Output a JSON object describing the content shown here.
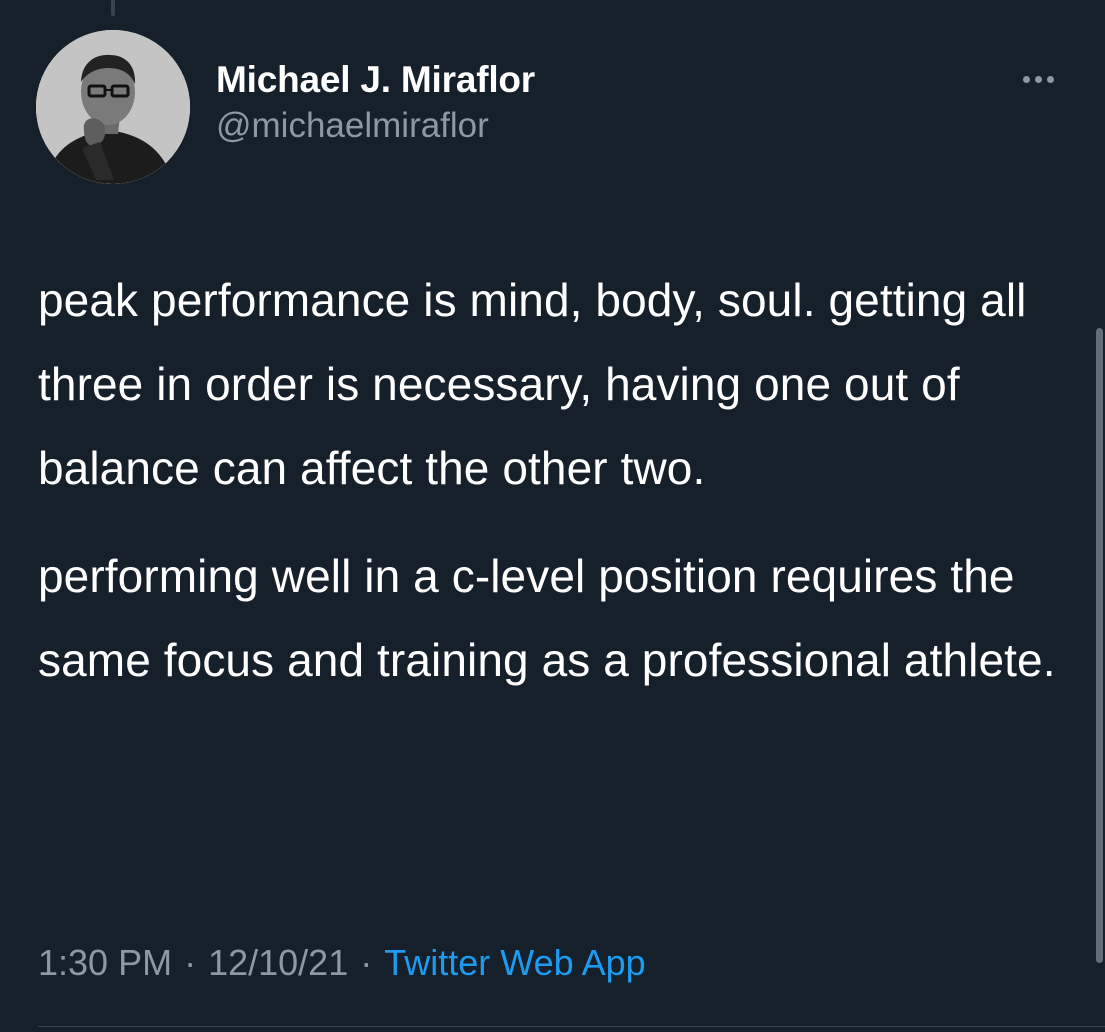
{
  "author": {
    "name": "Michael J. Miraflor",
    "handle": "@michaelmiraflor",
    "avatar_icon": "profile-photo"
  },
  "more_icon": "more-options-ellipsis-icon",
  "tweet": {
    "paragraphs": [
      "peak performance is mind, body, soul. getting all three in order is necessary, having one out of balance can affect the other two.",
      "performing well in a c-level position requires the same focus and training as a professional athlete."
    ]
  },
  "meta": {
    "time": "1:30 PM",
    "separator": "·",
    "date": "12/10/21",
    "source": "Twitter Web App"
  },
  "colors": {
    "background": "#15202b",
    "text": "#ffffff",
    "secondary": "#8b98a5",
    "link": "#1d9bf0"
  }
}
